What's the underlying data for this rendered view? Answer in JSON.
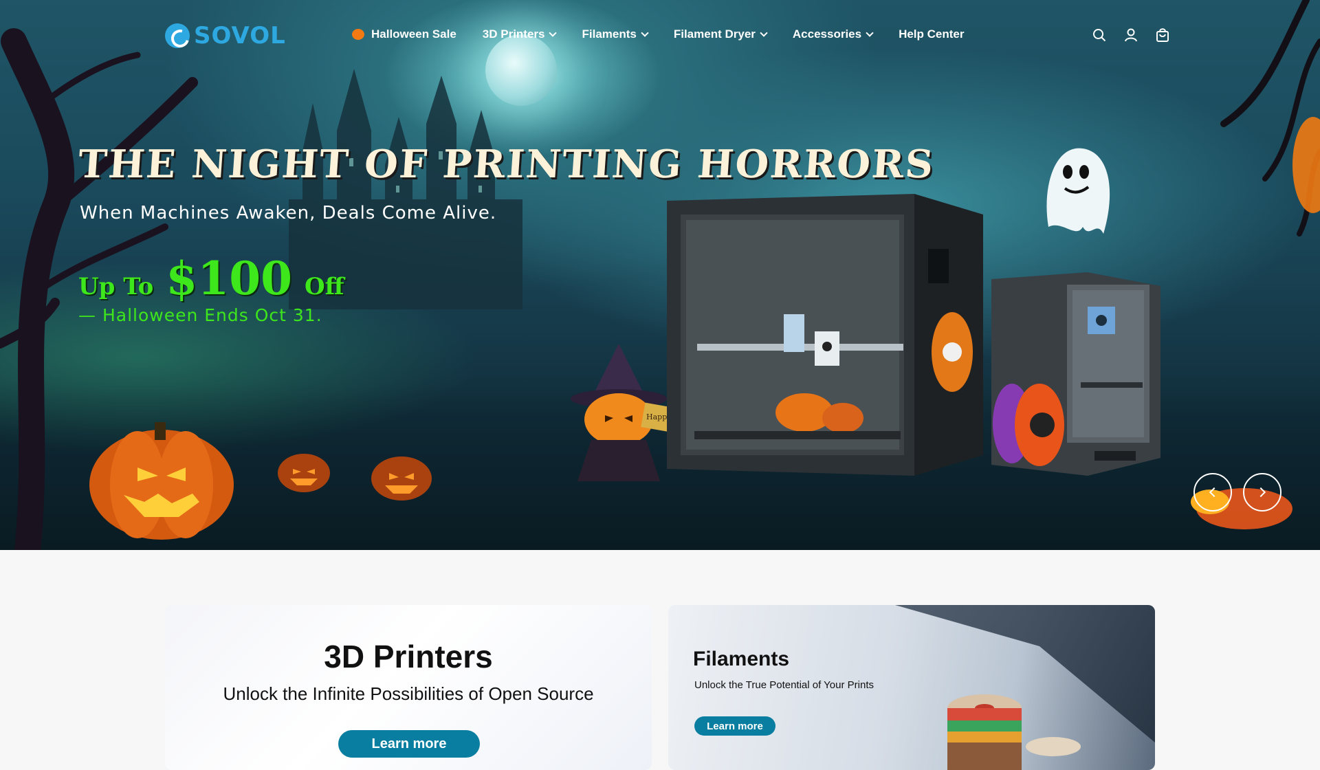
{
  "brand": {
    "name": "SOVOL",
    "color": "#2ea8e0"
  },
  "nav": {
    "items": [
      {
        "label": "Halloween Sale",
        "icon": "pumpkin-icon",
        "dropdown": false
      },
      {
        "label": "3D Printers",
        "dropdown": true
      },
      {
        "label": "Filaments",
        "dropdown": true
      },
      {
        "label": "Filament Dryer",
        "dropdown": true
      },
      {
        "label": "Accessories",
        "dropdown": true
      },
      {
        "label": "Help Center",
        "dropdown": false
      }
    ]
  },
  "header_icons": [
    "search-icon",
    "account-icon",
    "cart-icon"
  ],
  "hero": {
    "title": "The Night of Printing Horrors",
    "subtitle": "When Machines Awaken, Deals Come Alive.",
    "promo_prefix": "Up To",
    "promo_amount": "$100",
    "promo_suffix": "Off",
    "promo_end": "— Halloween Ends Oct 31.",
    "sign_text": "Happy Halloween",
    "accent_color": "#3ee61c"
  },
  "slider": {
    "prev_icon": "chevron-left-icon",
    "next_icon": "chevron-right-icon"
  },
  "cards": {
    "printers": {
      "title": "3D Printers",
      "subtitle": "Unlock the Infinite Possibilities of Open Source",
      "button": "Learn more"
    },
    "filaments": {
      "title": "Filaments",
      "subtitle": "Unlock the True Potential of Your Prints",
      "button": "Learn more"
    },
    "button_color": "#0a7ea0"
  }
}
